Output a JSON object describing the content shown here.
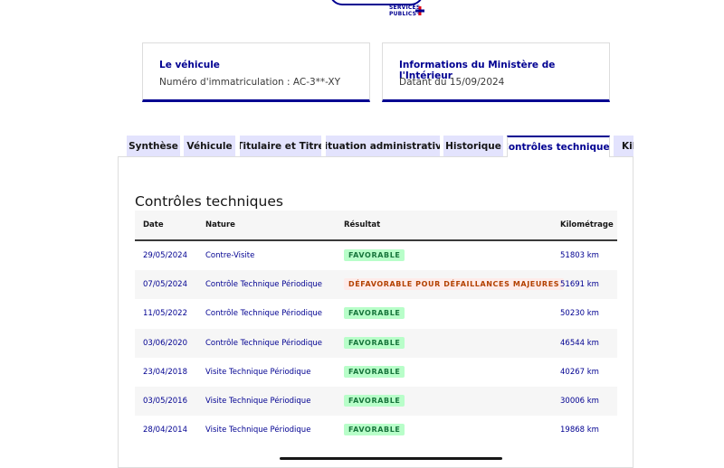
{
  "logo": {
    "line1": "SERVICES",
    "line2": "PUBLICS+"
  },
  "cards": [
    {
      "title": "Le véhicule",
      "text": "Numéro d'immatriculation : AC-3**-XY"
    },
    {
      "title": "Informations du Ministère de l'Intérieur",
      "text": "Datant du 15/09/2024"
    }
  ],
  "tabs": [
    {
      "label": "Synthèse"
    },
    {
      "label": "Véhicule"
    },
    {
      "label": "Titulaire et Titre"
    },
    {
      "label": "Situation administrative"
    },
    {
      "label": "Historique"
    },
    {
      "label": "Contrôles techniques"
    },
    {
      "label": "Kilométrage"
    }
  ],
  "section": {
    "title": "Contrôles techniques",
    "headers": {
      "date": "Date",
      "nature": "Nature",
      "result": "Résultat",
      "km": "Kilométrage"
    },
    "rows": [
      {
        "date": "29/05/2024",
        "nature": "Contre-Visite",
        "result": "FAVORABLE",
        "km": "51803 km"
      },
      {
        "date": "07/05/2024",
        "nature": "Contrôle Technique Périodique",
        "result": "DÉFAVORABLE POUR DÉFAILLANCES MAJEURES",
        "km": "51691 km"
      },
      {
        "date": "11/05/2022",
        "nature": "Contrôle Technique Périodique",
        "result": "FAVORABLE",
        "km": "50230 km"
      },
      {
        "date": "03/06/2020",
        "nature": "Contrôle Technique Périodique",
        "result": "FAVORABLE",
        "km": "46544 km"
      },
      {
        "date": "23/04/2018",
        "nature": "Visite Technique Périodique",
        "result": "FAVORABLE",
        "km": "40267 km"
      },
      {
        "date": "03/05/2016",
        "nature": "Visite Technique Périodique",
        "result": "FAVORABLE",
        "km": "30006 km"
      },
      {
        "date": "28/04/2014",
        "nature": "Visite Technique Périodique",
        "result": "FAVORABLE",
        "km": "19868 km"
      }
    ]
  },
  "colors": {
    "primary": "#000091",
    "ok_bg": "#b8fec9",
    "ok_fg": "#18753c",
    "ko_bg": "#feebe9",
    "ko_fg": "#b34000"
  }
}
